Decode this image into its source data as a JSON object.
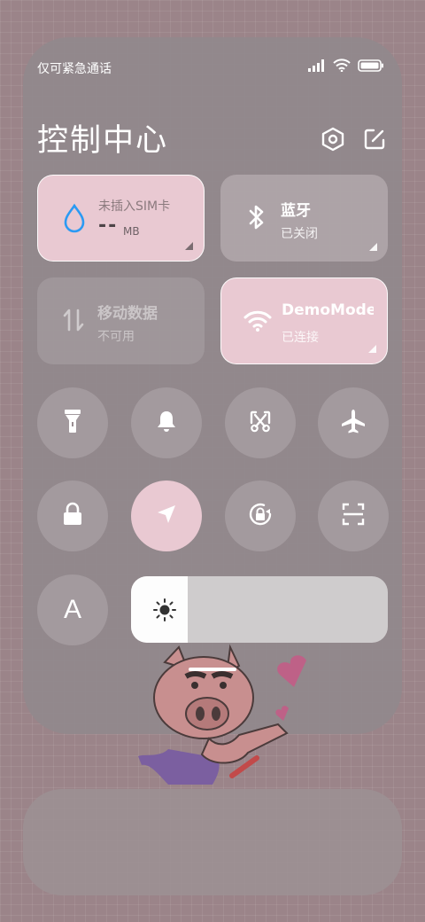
{
  "status_bar": {
    "carrier": "仅可紧急通话",
    "battery_icon": "battery-full-icon",
    "wifi_icon": "wifi-icon",
    "signal_icon": "signal-bars-icon"
  },
  "header": {
    "title": "控制中心",
    "settings_icon": "gear-hexagon-icon",
    "edit_icon": "edit-icon"
  },
  "tiles": {
    "data_usage": {
      "label": "未插入SIM卡",
      "value": "--",
      "unit": "MB",
      "icon": "water-drop-icon"
    },
    "bluetooth": {
      "label": "蓝牙",
      "status": "已关闭",
      "icon": "bluetooth-icon"
    },
    "mobile_data": {
      "label": "移动数据",
      "status": "不可用",
      "icon": "data-arrows-icon"
    },
    "wifi": {
      "label": "DemoMode",
      "status": "已连接",
      "icon": "wifi-icon"
    }
  },
  "toggles_row1": [
    "flashlight-icon",
    "bell-icon",
    "screenshot-icon",
    "airplane-icon"
  ],
  "toggles_row2": [
    "lock-icon",
    "location-icon",
    "rotation-lock-icon",
    "scan-icon"
  ],
  "font_button": {
    "label": "A"
  },
  "brightness": {
    "level_percent": 22,
    "icon": "sun-icon"
  },
  "colors": {
    "accent_pink": "#e9c9d2",
    "bluetooth_blue": "#2b9af3"
  }
}
